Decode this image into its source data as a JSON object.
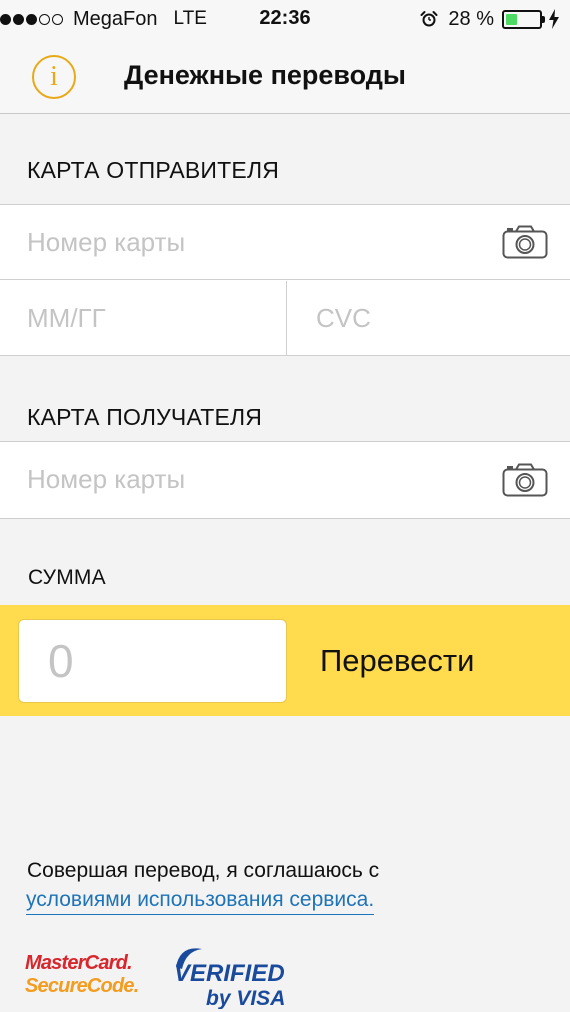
{
  "status_bar": {
    "signal_total": 5,
    "signal_filled": 3,
    "carrier": "MegaFon",
    "network": "LTE",
    "time": "22:36",
    "battery_percent": "28 %",
    "battery_level": 0.28,
    "icons": [
      "alarm-icon",
      "battery-icon",
      "charging-bolt-icon"
    ]
  },
  "nav": {
    "title": "Денежные переводы",
    "info_icon": "i"
  },
  "sender": {
    "section_title": "КАРТА ОТПРАВИТЕЛЯ",
    "card_number_placeholder": "Номер карты",
    "expiry_placeholder": "ММ/ГГ",
    "cvc_placeholder": "CVC"
  },
  "recipient": {
    "section_title": "КАРТА ПОЛУЧАТЕЛЯ",
    "card_number_placeholder": "Номер карты"
  },
  "amount": {
    "section_title": "СУММА",
    "placeholder": "0",
    "transfer_label": "Перевести"
  },
  "footer": {
    "agree_text": "Совершая перевод, я соглашаюсь с",
    "terms_link": "условиями использования сервиса."
  },
  "logos": {
    "mastercard_line1": "MasterCard.",
    "mastercard_line2": "SecureCode.",
    "visa_line1": "VERIFIED",
    "visa_line2": "by VISA"
  },
  "colors": {
    "accent_yellow": "#ffdb4d",
    "info_orange": "#e8a917",
    "link_blue": "#1f73b7",
    "placeholder_gray": "#c4c4c4",
    "battery_green": "#4cd964"
  }
}
